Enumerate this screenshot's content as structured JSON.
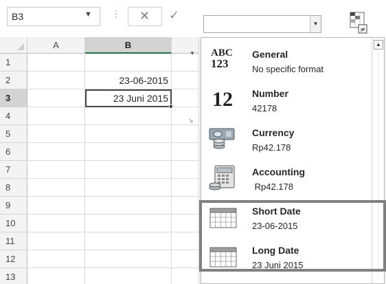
{
  "name_box": {
    "value": "B3"
  },
  "formula_bar": {
    "cancel_icon": "close-icon",
    "enter_icon": "check-icon",
    "separator": "⋮"
  },
  "sheet": {
    "columns": [
      "A",
      "B"
    ],
    "selected_column": "B",
    "rows": [
      {
        "num": "1",
        "a": "",
        "b": ""
      },
      {
        "num": "2",
        "a": "",
        "b": "23-06-2015"
      },
      {
        "num": "3",
        "a": "",
        "b": "23 Juni 2015"
      },
      {
        "num": "4",
        "a": "",
        "b": ""
      },
      {
        "num": "5",
        "a": "",
        "b": ""
      },
      {
        "num": "6",
        "a": "",
        "b": ""
      },
      {
        "num": "7",
        "a": "",
        "b": ""
      },
      {
        "num": "8",
        "a": "",
        "b": ""
      },
      {
        "num": "9",
        "a": "",
        "b": ""
      },
      {
        "num": "10",
        "a": "",
        "b": ""
      },
      {
        "num": "11",
        "a": "",
        "b": ""
      },
      {
        "num": "12",
        "a": "",
        "b": ""
      },
      {
        "num": "13",
        "a": "",
        "b": ""
      }
    ],
    "active_cell": "B3"
  },
  "number_format_dropdown": {
    "combo_value": "",
    "items": [
      {
        "name": "General",
        "sample": "No specific format",
        "icon": "general-format-icon",
        "icon_text_top": "ABC",
        "icon_text_bottom": "123"
      },
      {
        "name": "Number",
        "sample": "42178",
        "icon": "number-format-icon",
        "icon_text_top": "12"
      },
      {
        "name": "Currency",
        "sample": "Rp42.178",
        "icon": "currency-format-icon"
      },
      {
        "name": "Accounting",
        "sample": " Rp42.178",
        "icon": "accounting-format-icon"
      },
      {
        "name": "Short Date",
        "sample": "23-06-2015",
        "icon": "calendar-icon"
      },
      {
        "name": "Long Date",
        "sample": "23 Juni 2015",
        "icon": "calendar-icon"
      }
    ],
    "highlighted": [
      "Short Date",
      "Long Date"
    ]
  },
  "colors": {
    "accent": "#217346",
    "highlight_border": "#808080",
    "header_bg": "#f3f3f3",
    "selected_header_bg": "#d3d3d3"
  }
}
